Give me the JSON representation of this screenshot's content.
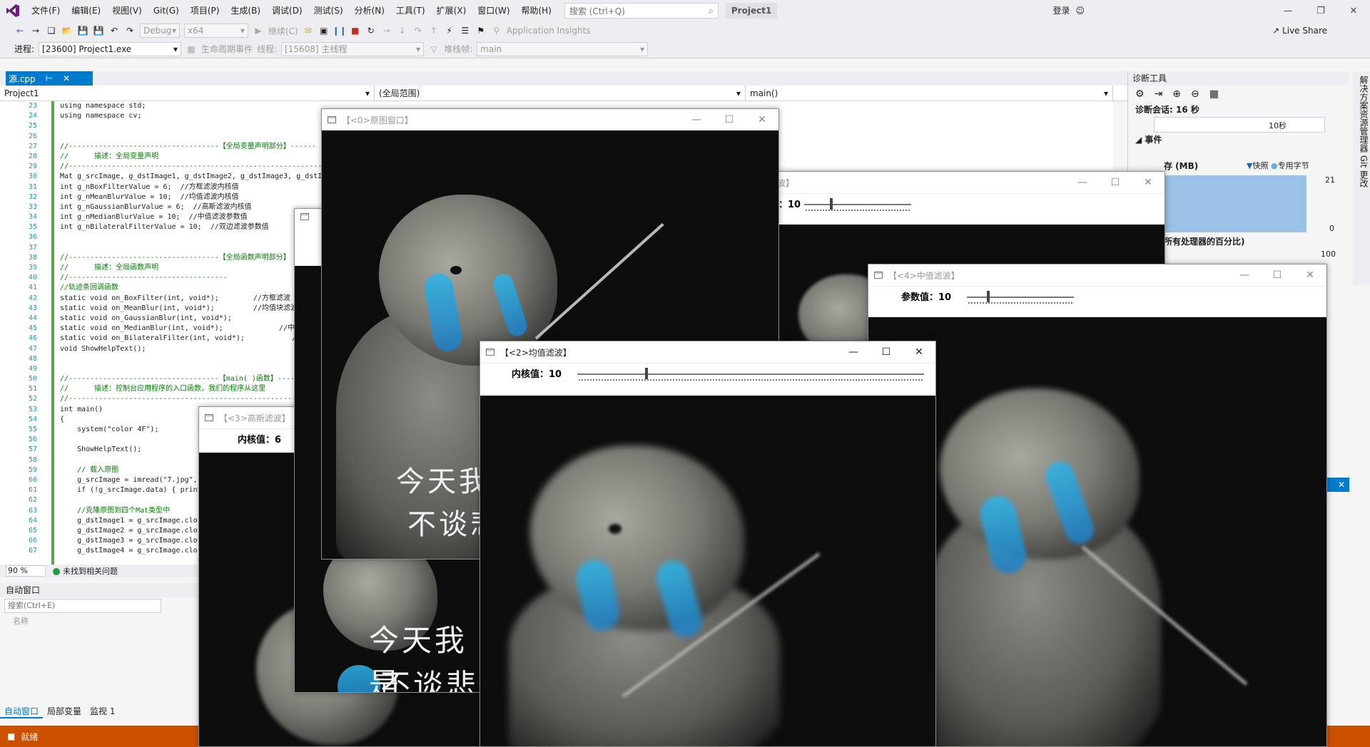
{
  "menubar": {
    "items": [
      "文件(F)",
      "编辑(E)",
      "视图(V)",
      "Git(G)",
      "项目(P)",
      "生成(B)",
      "调试(D)",
      "测试(S)",
      "分析(N)",
      "工具(T)",
      "扩展(X)",
      "窗口(W)",
      "帮助(H)"
    ],
    "search_placeholder": "搜索 (Ctrl+Q)",
    "project_name": "Project1",
    "login": "登录"
  },
  "toolbar": {
    "config": "Debug",
    "platform": "x64",
    "continue": "继续(C)",
    "app_insights": "Application Insights",
    "live_share": "Live Share",
    "process_label": "进程:",
    "process_value": "[23600] Project1.exe",
    "lifecycle": "生命周期事件",
    "thread_label": "线程:",
    "thread_value": "[15608] 主线程",
    "stackframe_label": "堆栈帧:",
    "stackframe_value": "main"
  },
  "editor": {
    "tab_label": "源.cpp",
    "nav_project": "Project1",
    "nav_scope": "(全局范围)",
    "nav_function": "main()",
    "zoom": "90 %",
    "issues": "未找到相关问题",
    "line_numbers": [
      "23",
      "24",
      "25",
      "26",
      "27",
      "28",
      "29",
      "30",
      "31",
      "32",
      "33",
      "34",
      "35",
      "36",
      "37",
      "38",
      "39",
      "40",
      "41",
      "42",
      "43",
      "44",
      "45",
      "46",
      "47",
      "48",
      "49",
      "50",
      "51",
      "52",
      "53",
      "54",
      "55",
      "56",
      "57",
      "58",
      "59",
      "60",
      "61",
      "62",
      "63",
      "64",
      "65",
      "66",
      "67"
    ],
    "lines": [
      "using namespace std;",
      "using namespace cv;",
      "",
      "",
      "//-----------------------------------【全局变量声明部分】------",
      "//      描述：全局变量声明",
      "//-----------------------------------------------------------",
      "Mat g_srcImage, g_dstImage1, g_dstImage2, g_dstImage3, g_dstIm",
      "int g_nBoxFilterValue = 6;  //方框滤波内核值",
      "int g_nMeanBlurValue = 10;  //均值滤波内核值",
      "int g_nGaussianBlurValue = 6;  //高斯滤波内核值",
      "int g_nMedianBlurValue = 10;  //中值滤波参数值",
      "int g_nBilateralFilterValue = 10;  //双边滤波参数值",
      "",
      "",
      "//-----------------------------------【全局函数声明部分】",
      "//      描述：全局函数声明",
      "//-------------------------------------",
      "//轨迹条回调函数",
      "static void on_BoxFilter(int, void*);        //方框滤波",
      "static void on_MeanBlur(int, void*);         //均值块滤波",
      "static void on_GaussianBlur(int, void*);                  //高",
      "static void on_MedianBlur(int, void*);             //中值滤",
      "static void on_BilateralFilter(int, void*);           //双",
      "void ShowHelpText();",
      "",
      "",
      "//-----------------------------------【main( )函数】----",
      "//      描述：控制台应用程序的入口函数，我们的程序从这里",
      "//-----------------------------------------------------",
      "int main()",
      "{",
      "    system(\"color 4F\");",
      "",
      "    ShowHelpText();",
      "",
      "    // 载入原图",
      "    g_srcImage = imread(\"7.jpg\",",
      "    if (!g_srcImage.data) { print",
      "",
      "    //克隆原图到四个Mat类型中",
      "    g_dstImage1 = g_srcImage.clo",
      "    g_dstImage2 = g_srcImage.clo",
      "    g_dstImage3 = g_srcImage.clo",
      "    g_dstImage4 = g_srcImage.clo"
    ]
  },
  "auto_window": {
    "title": "自动窗口",
    "search_placeholder": "搜索(Ctrl+E)",
    "column_name": "名称",
    "tabs": [
      "自动窗口",
      "局部变量",
      "监视 1"
    ]
  },
  "statusbar": {
    "text": "就绪"
  },
  "diagnostics": {
    "title": "诊断工具",
    "session": "诊断会话: 16 秒",
    "timeline_tick": "10秒",
    "events": "事件",
    "memory": "存 (MB)",
    "snapshot": "快照",
    "private_bytes": "专用字节",
    "mem_max": "21",
    "mem_min": "0",
    "cpu_label": "所有处理器的百分比)",
    "cpu_max": "100",
    "side_strip": "解决方案资源管理器  Git 更改"
  },
  "cv_windows": {
    "w0": {
      "title": "【<0>原图窗口】"
    },
    "w1": {
      "title": "波】",
      "label": "：10",
      "value": 10,
      "max": 40
    },
    "w4": {
      "title": "【<4>中值滤波】",
      "label": "参数值：10",
      "value": 10,
      "max": 50
    },
    "w2": {
      "title": "【<2>均值滤波】",
      "label": "内核值：10",
      "value": 10,
      "max": 50
    },
    "w3": {
      "title": "【<3>高斯滤波】",
      "label": "内核值：6"
    }
  },
  "captions": {
    "line1": "今天我是演奏的狗",
    "line2": "不谈悲伤",
    "line1_short": "今天我",
    "line2_short": "不谈悲",
    "line1_mid": "今天我是",
    "line2_mid": "不谈悲"
  }
}
